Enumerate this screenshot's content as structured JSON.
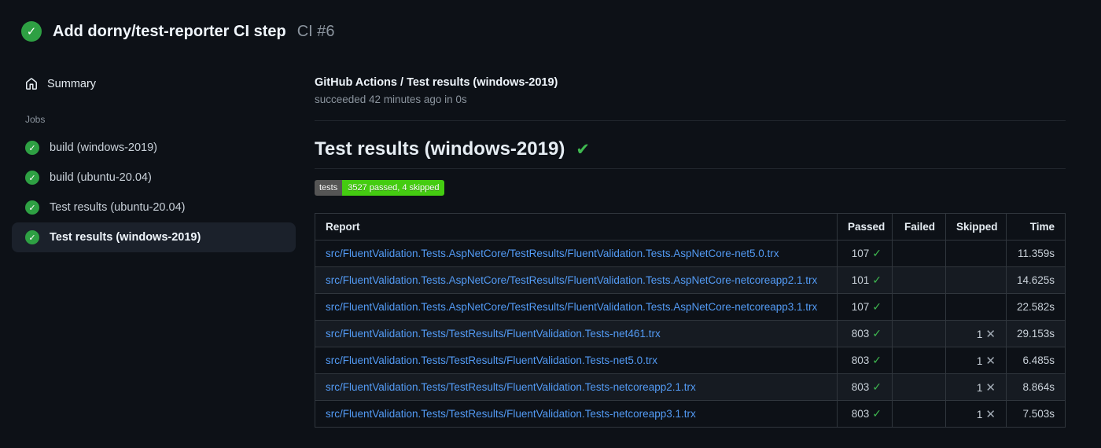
{
  "run": {
    "title": "Add dorny/test-reporter CI step",
    "number": "CI #6",
    "status_icon": "success-check"
  },
  "sidebar": {
    "summary_label": "Summary",
    "jobs_label": "Jobs",
    "jobs": [
      {
        "label": "build (windows-2019)",
        "status": "success",
        "selected": false
      },
      {
        "label": "build (ubuntu-20.04)",
        "status": "success",
        "selected": false
      },
      {
        "label": "Test results (ubuntu-20.04)",
        "status": "success",
        "selected": false
      },
      {
        "label": "Test results (windows-2019)",
        "status": "success",
        "selected": true
      }
    ]
  },
  "main": {
    "job_title": "GitHub Actions / Test results (windows-2019)",
    "job_status": "succeeded 42 minutes ago in 0s",
    "section_title": "Test results (windows-2019)",
    "badge": {
      "label": "tests",
      "value": "3527 passed, 4 skipped"
    },
    "table": {
      "headers": [
        "Report",
        "Passed",
        "Failed",
        "Skipped",
        "Time"
      ],
      "rows": [
        {
          "report": "src/FluentValidation.Tests.AspNetCore/TestResults/FluentValidation.Tests.AspNetCore-net5.0.trx",
          "passed": "107",
          "failed": "",
          "skipped": "",
          "time": "11.359s"
        },
        {
          "report": "src/FluentValidation.Tests.AspNetCore/TestResults/FluentValidation.Tests.AspNetCore-netcoreapp2.1.trx",
          "passed": "101",
          "failed": "",
          "skipped": "",
          "time": "14.625s"
        },
        {
          "report": "src/FluentValidation.Tests.AspNetCore/TestResults/FluentValidation.Tests.AspNetCore-netcoreapp3.1.trx",
          "passed": "107",
          "failed": "",
          "skipped": "",
          "time": "22.582s"
        },
        {
          "report": "src/FluentValidation.Tests/TestResults/FluentValidation.Tests-net461.trx",
          "passed": "803",
          "failed": "",
          "skipped": "1",
          "time": "29.153s"
        },
        {
          "report": "src/FluentValidation.Tests/TestResults/FluentValidation.Tests-net5.0.trx",
          "passed": "803",
          "failed": "",
          "skipped": "1",
          "time": "6.485s"
        },
        {
          "report": "src/FluentValidation.Tests/TestResults/FluentValidation.Tests-netcoreapp2.1.trx",
          "passed": "803",
          "failed": "",
          "skipped": "1",
          "time": "8.864s"
        },
        {
          "report": "src/FluentValidation.Tests/TestResults/FluentValidation.Tests-netcoreapp3.1.trx",
          "passed": "803",
          "failed": "",
          "skipped": "1",
          "time": "7.503s"
        }
      ]
    }
  },
  "icons": {
    "success_check": "✓",
    "heading_check": "✔",
    "pass_mark": "✓",
    "skip_mark": "✕"
  },
  "colors": {
    "background": "#0d1117",
    "success_green": "#2ea043",
    "check_green": "#3fb950",
    "badge_green": "#44cc11",
    "badge_gray": "#555555",
    "link_blue": "#539bf5",
    "border": "#30363d",
    "divider": "#21262d",
    "row_alt": "#161b22",
    "selected_item_bg": "#1b212b",
    "text_primary": "#e6edf3",
    "text_secondary": "#8b949e"
  }
}
